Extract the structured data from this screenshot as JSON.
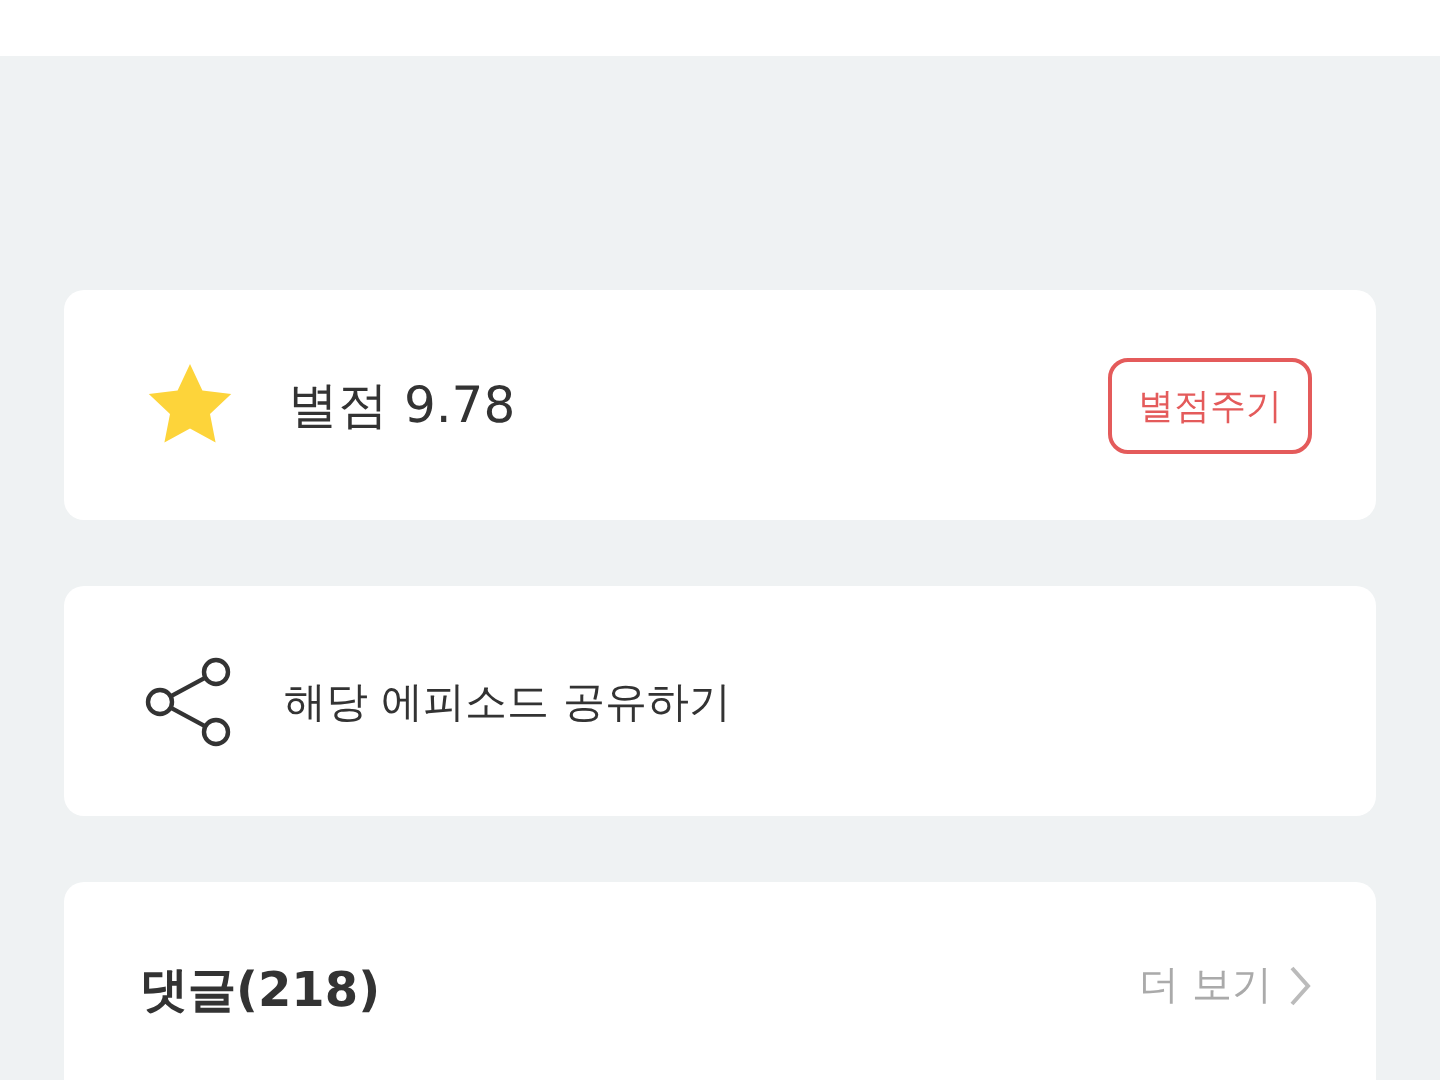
{
  "rating": {
    "label": "별점",
    "score": "9.78",
    "button": "별점주기"
  },
  "share": {
    "label": "해당 에피소드 공유하기"
  },
  "comments": {
    "title": "댓글(218)",
    "more": "더 보기"
  }
}
